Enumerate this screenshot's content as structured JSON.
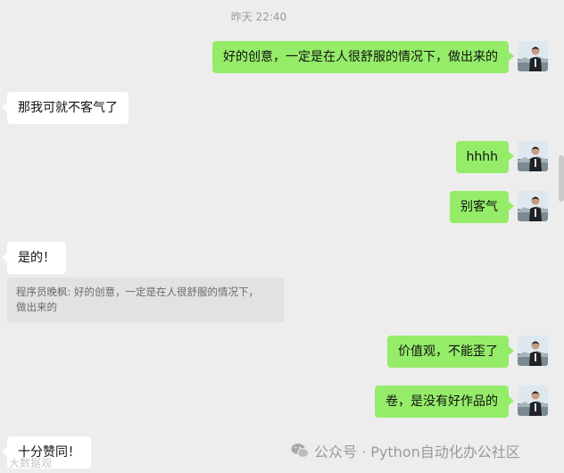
{
  "chat": {
    "timestamp": "昨天 22:40",
    "messages": [
      {
        "side": "right",
        "text": "好的创意，一定是在人很舒服的情况下，做出来的"
      },
      {
        "side": "left",
        "text": "那我可就不客气了"
      },
      {
        "side": "right",
        "text": "hhhh"
      },
      {
        "side": "right",
        "text": "别客气"
      },
      {
        "side": "left",
        "text": "是的！"
      },
      {
        "side": "right",
        "text": "价值观，不能歪了"
      },
      {
        "side": "right",
        "text": "卷，是没有好作品的"
      },
      {
        "side": "left",
        "text": "十分赞同！"
      }
    ],
    "quote": {
      "line1": "程序员晚枫: 好的创意，一定是在人很舒服的情况下，",
      "line2": "做出来的"
    }
  },
  "watermark": {
    "text": "公众号 · Python自动化办公社区",
    "icon": "wechat-icon"
  },
  "bottom_mark": "大数据观"
}
